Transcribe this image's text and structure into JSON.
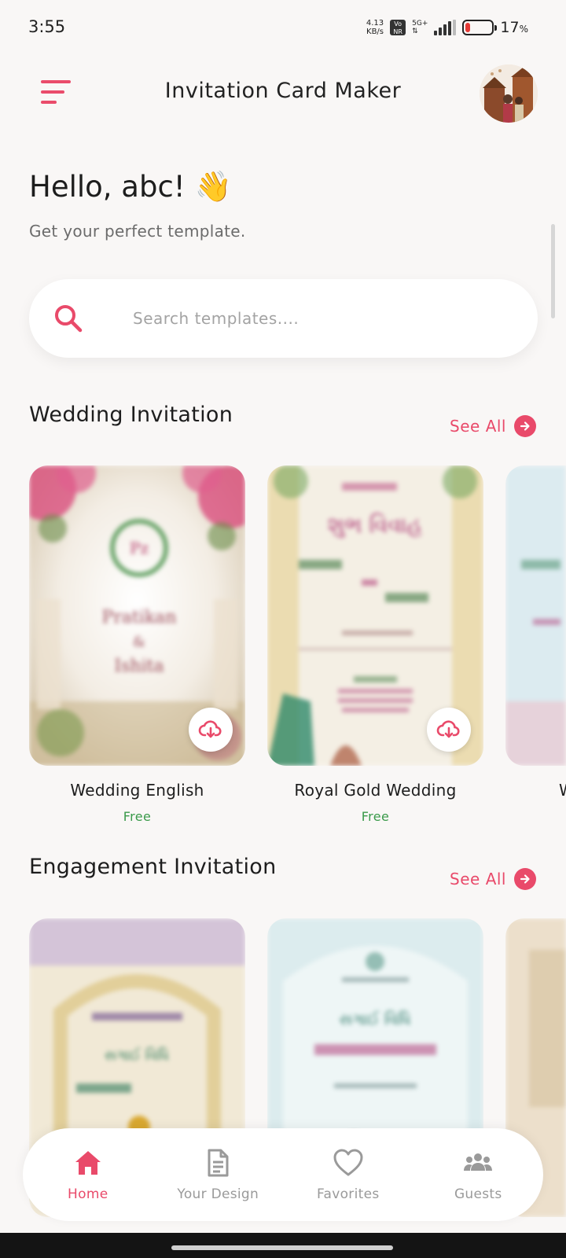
{
  "status_bar": {
    "time": "3:55",
    "speed_value": "4.13",
    "speed_unit": "KB/s",
    "volte_top": "Vo",
    "volte_bottom": "NR",
    "network": "5G+",
    "battery_percent": "17",
    "battery_unit": "%",
    "battery_level": 0.17
  },
  "header": {
    "title": "Invitation Card Maker",
    "menu_icon": "hamburger-menu-icon",
    "avatar_icon": "profile-avatar"
  },
  "greeting": {
    "hello": "Hello, abc!",
    "emoji": "👋",
    "subtitle": "Get your perfect template."
  },
  "search": {
    "placeholder": "Search templates....",
    "value": ""
  },
  "sections": [
    {
      "title": "Wedding Invitation",
      "see_all": "See All",
      "cards": [
        {
          "name": "Wedding English",
          "price": "Free"
        },
        {
          "name": "Royal Gold Wedding",
          "price": "Free"
        },
        {
          "name": "W",
          "price": ""
        }
      ]
    },
    {
      "title": "Engagement Invitation",
      "see_all": "See All"
    }
  ],
  "bottom_nav": [
    {
      "label": "Home",
      "icon": "home-icon",
      "active": true
    },
    {
      "label": "Your Design",
      "icon": "document-icon",
      "active": false
    },
    {
      "label": "Favorites",
      "icon": "heart-icon",
      "active": false
    },
    {
      "label": "Guests",
      "icon": "group-icon",
      "active": false
    }
  ],
  "colors": {
    "accent": "#e94a6a",
    "free_green": "#3a9a4a",
    "background": "#f9f7f6"
  }
}
